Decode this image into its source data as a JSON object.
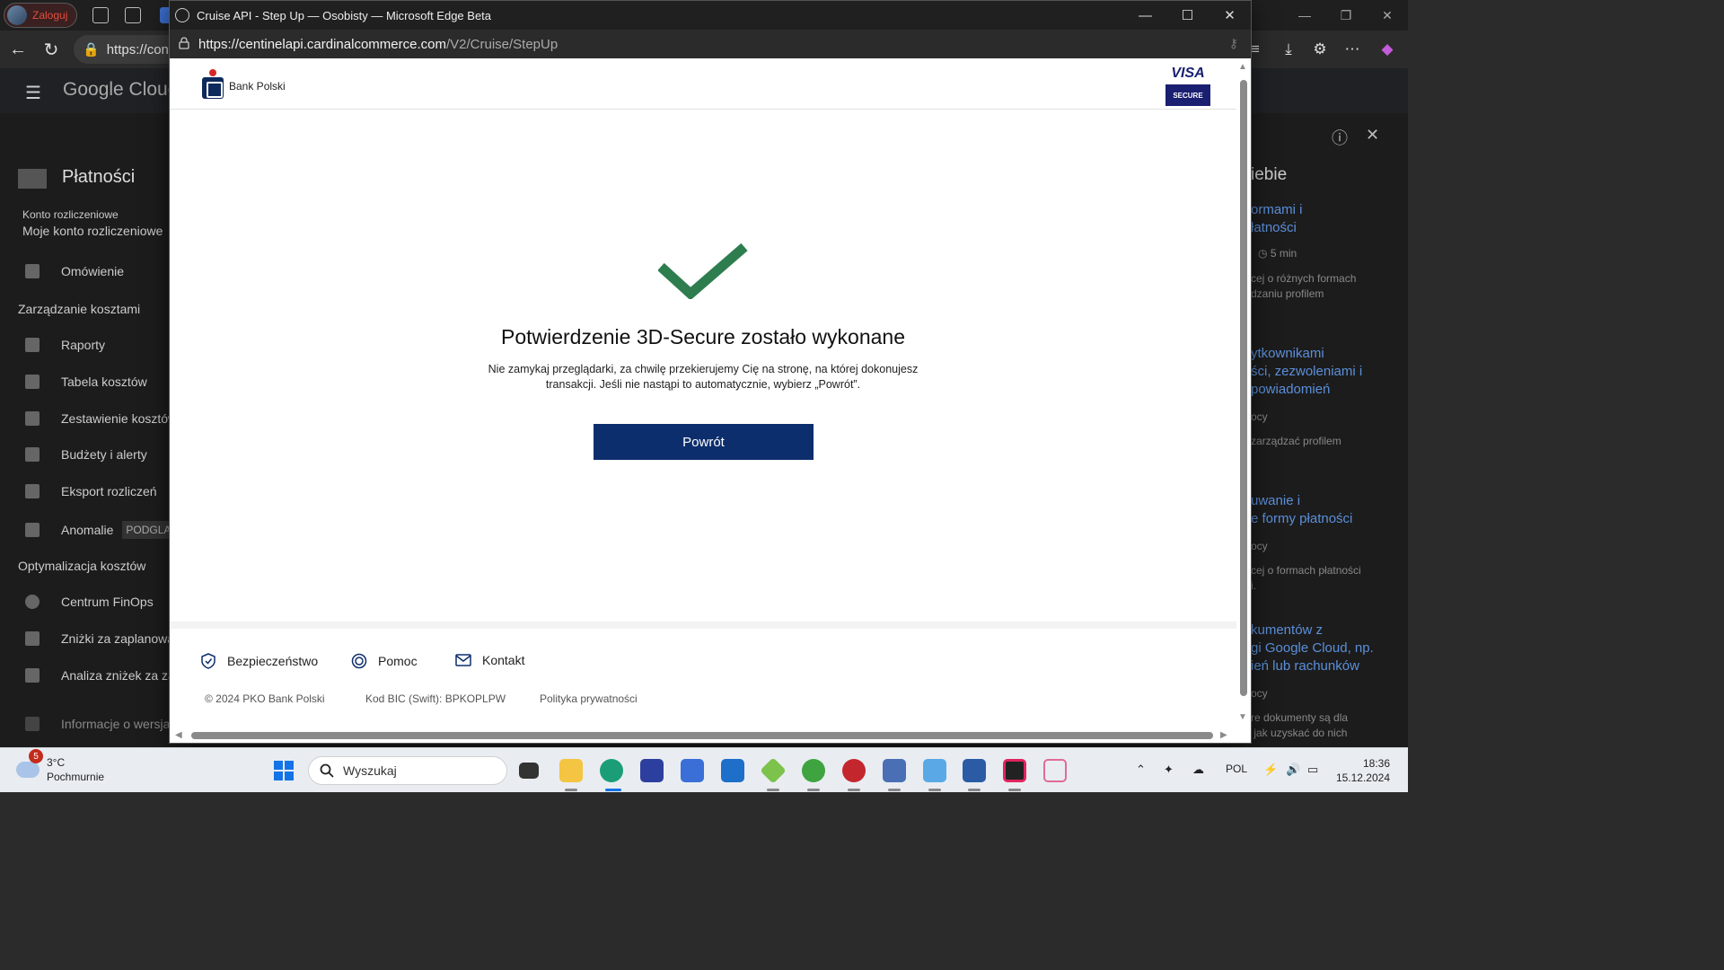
{
  "background_browser": {
    "profile_label": "Zaloguj",
    "address_text": "https://cons",
    "page": {
      "logo_text": "Google Cloud",
      "section_title": "Płatności",
      "account_label": "Konto rozliczeniowe",
      "account_name": "Moje konto rozliczeniowe",
      "nav": [
        {
          "label": "Omówienie"
        },
        {
          "section": "Zarządzanie kosztami"
        },
        {
          "label": "Raporty"
        },
        {
          "label": "Tabela kosztów"
        },
        {
          "label": "Zestawienie kosztów"
        },
        {
          "label": "Budżety i alerty"
        },
        {
          "label": "Eksport rozliczeń"
        },
        {
          "label": "Anomalie",
          "badge": "PODGLĄD"
        },
        {
          "section": "Optymalizacja kosztów"
        },
        {
          "label": "Centrum FinOps"
        },
        {
          "label": "Zniżki za zaplanowane"
        },
        {
          "label": "Analiza zniżek za za"
        },
        {
          "label": "Informacje o wersjach"
        }
      ],
      "collapse_label": "‹|",
      "right_panel": {
        "title": "iebie",
        "items": [
          {
            "link": "ormami i\nłatności",
            "meta": "5 min",
            "text": "cej o różnych formach\ndzaniu profilem"
          },
          {
            "link": "ytkownikami\nści, zezwoleniami i\npowiadomień",
            "meta": "ocy",
            "text": "zarządzać profilem"
          },
          {
            "link": "uwanie i\ne formy płatności",
            "meta": "ocy",
            "text": "cej o formach płatności\ni."
          },
          {
            "link": "kumentów z\ngi Google Cloud, np.\nień lub rachunków",
            "meta": "ocy",
            "text": "re dokumenty są dla\n jak uzyskać do nich"
          }
        ]
      }
    }
  },
  "popup": {
    "window_title": "Cruise API - Step Up — Osobisty — Microsoft Edge Beta",
    "url_host": "https://centinelapi.cardinalcommerce.com",
    "url_path": "/V2/Cruise/StepUp",
    "bank_name": "Bank Polski",
    "visa_label": "VISA",
    "visa_secure_label": "SECURE",
    "confirm_title": "Potwierdzenie 3D-Secure zostało wykonane",
    "confirm_desc": "Nie zamykaj przeglądarki, za chwilę przekierujemy Cię na stronę, na której dokonujesz transakcji. Jeśli nie nastąpi to automatycznie, wybierz „Powrót”.",
    "back_button": "Powrót",
    "footer": {
      "security": "Bezpieczeństwo",
      "help": "Pomoc",
      "contact": "Kontakt",
      "copyright": "© 2024 PKO Bank Polski",
      "bic": "Kod BIC (Swift): BPKOPLPW",
      "privacy": "Polityka prywatności"
    },
    "colors": {
      "check": "#2e7d4f",
      "button": "#0d2e6d",
      "visa": "#1a1f71"
    }
  },
  "taskbar": {
    "weather_badge": "5",
    "weather_temp": "3°C",
    "weather_desc": "Pochmurnie",
    "search_placeholder": "Wyszukaj",
    "language": "POL",
    "time": "18:36",
    "date": "15.12.2024",
    "apps": [
      "file-explorer-icon",
      "edge-beta-icon",
      "save-icon",
      "store-icon",
      "outlook-icon",
      "git-icon",
      "globe-app-icon",
      "red-app-icon",
      "network-app-icon",
      "rdp-icon",
      "virtualbox-icon",
      "rider-icon",
      "snipping-icon"
    ]
  }
}
